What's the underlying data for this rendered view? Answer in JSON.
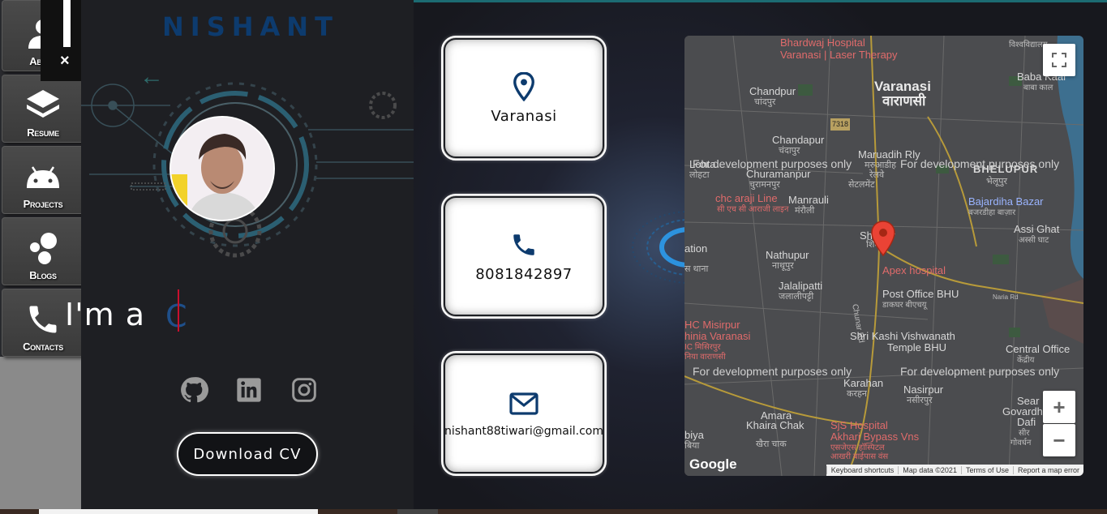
{
  "brand": "NISHANT",
  "nav": {
    "items": [
      {
        "label": "About",
        "icon": "person-icon"
      },
      {
        "label": "Resume",
        "icon": "layers-icon"
      },
      {
        "label": "Projects",
        "icon": "android-icon"
      },
      {
        "label": "Blogs",
        "icon": "bubbles-icon"
      },
      {
        "label": "Contacts",
        "icon": "phone-icon"
      }
    ],
    "close": "×"
  },
  "profile": {
    "intro": "I'm a",
    "typed": "C",
    "download_cv": "Download CV"
  },
  "contact": {
    "location": "Varanasi",
    "phone": "8081842897",
    "email": "nishant88tiwari@gmail.com"
  },
  "map": {
    "dev_notice": "For development purposes only",
    "labels": {
      "bhardwaj": "Bhardwaj Hospital",
      "varanasi_laser": "Varanasi | Laser Therapy",
      "bhardwaj_hi": "विश्वविद्यालय",
      "varanasi": "Varanasi",
      "varanasi_hi": "वाराणसी",
      "baba_kaal": "Baba Kaal",
      "baba_kaal_hi": "बाबा काल",
      "chandpur": "Chandpur",
      "chandpur_hi": "चांदपुर",
      "road_7318": "7318",
      "chandapur": "Chandapur",
      "chandapur_hi": "चंदापुर",
      "maruadih": "Maruadih Rly",
      "maruadih_hi1": "मरुआडीह",
      "maruadih_hi2": "रेलवे",
      "maruadih_hi3": "सेटलमेंट",
      "lohta": "Lohta",
      "lohta_hi": "लोहटा",
      "churamanpur": "Churamanpur",
      "churamanpur_hi": "चुरामनपुर",
      "bhelupur": "BHELUPUR",
      "bhelupur_hi": "भेलूपुर",
      "chc_araji": "chc araji Line",
      "chc_araji_hi": "सी एच सी आराजी लाइन",
      "manrauli": "Manrauli",
      "manrauli_hi": "मंरौली",
      "bajardiha": "Bajardiha Bazar",
      "bajardiha_hi": "बजरडीहा बाज़ार",
      "station": "ation",
      "station_hi": "स थाना",
      "shivpur": "Shivpur",
      "shivpur_hi": "शिवपुर",
      "assi_ghat": "Assi Ghat",
      "assi_ghat_hi": "अस्सी घाट",
      "nathupur": "Nathupur",
      "nathupur_hi": "नाथूपुर",
      "apex": "Apex hospital",
      "jalalipatti": "Jalalipatti",
      "jalalipatti_hi": "जलालीपट्टी",
      "post_office": "Post Office BHU",
      "post_office_hi": "डाकघर बीएचयू",
      "chunar_rd": "Chunar Rd",
      "hc_misirpur": "HC Misirpur",
      "hc_misirpur2": "hinia Varanasi",
      "hc_misirpur_hi1": "IC मिसिरपुर",
      "hc_misirpur_hi2": "निया वाराणसी",
      "kashi": "Shri Kashi Vishwanath",
      "kashi2": "Temple BHU",
      "central_office": "Central Office",
      "central_office_hi": "केंद्रीय",
      "karahan": "Karahan",
      "karahan_hi": "करहन",
      "nasirpur": "Nasirpur",
      "nasirpur_hi": "नसीरपुर",
      "sear": "Sear",
      "govardhan": "Govardhan",
      "dafi": "Dafi",
      "dafi_hi1": "सीर",
      "dafi_hi2": "गोवर्धन",
      "amara": "Amara",
      "khaira": "Khaira Chak",
      "khaira_hi": "खैरा चाक",
      "sjs": "SjS Hospital",
      "akhari": "Akhari Bypass Vns",
      "sjs_hi1": "एसजेएस हॉस्पिटल",
      "sjs_hi2": "आखरी बाईपास वंस",
      "biya": "biya",
      "biya_hi": "बिया",
      "naria": "Naria Rd"
    },
    "footer": [
      "Keyboard shortcuts",
      "Map data ©2021",
      "Terms of Use",
      "Report a map error"
    ],
    "zoom_in": "+",
    "zoom_out": "−",
    "google": "Google"
  },
  "colors": {
    "accent_blue": "#0d3b6e",
    "caret_red": "#c8102e",
    "pin_red": "#ea4335"
  }
}
